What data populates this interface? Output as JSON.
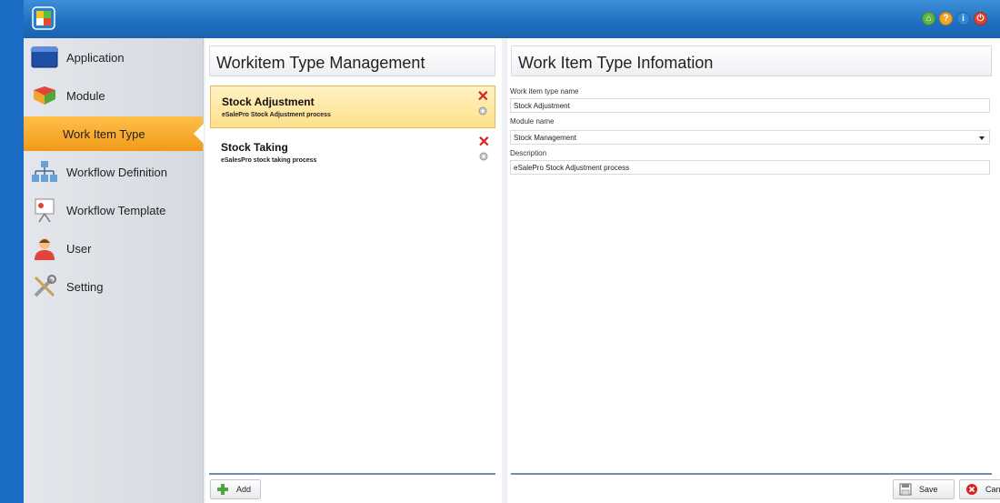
{
  "titlebar": {
    "accent": "#1f6fc2",
    "icons": [
      "home-icon",
      "help-icon",
      "info-icon",
      "power-icon"
    ]
  },
  "sidebar": {
    "items": [
      {
        "label": "Application",
        "icon": "application-window-icon",
        "active": false
      },
      {
        "label": "Module",
        "icon": "module-puzzle-icon",
        "active": false
      },
      {
        "label": "Work Item Type",
        "icon": "",
        "active": true
      },
      {
        "label": "Workflow Definition",
        "icon": "workflow-hierarchy-icon",
        "active": false
      },
      {
        "label": "Workflow Template",
        "icon": "presentation-board-icon",
        "active": false
      },
      {
        "label": "User",
        "icon": "user-icon",
        "active": false
      },
      {
        "label": "Setting",
        "icon": "tools-icon",
        "active": false
      }
    ]
  },
  "list_panel": {
    "title": "Workitem Type Management",
    "items": [
      {
        "name": "Stock Adjustment",
        "description": "eSalePro Stock Adjustment process",
        "selected": true
      },
      {
        "name": "Stock Taking",
        "description": "eSalesPro stock taking process",
        "selected": false
      }
    ],
    "add_label": "Add"
  },
  "detail_panel": {
    "title": "Work Item Type Infomation",
    "type_name_label": "Work item type name",
    "type_name_value": "Stock Adjustment",
    "module_label": "Module name",
    "module_value": "Stock Management",
    "description_label": "Description",
    "description_value": "eSalePro Stock Adjustment process",
    "save_label": "Save",
    "cancel_label": "Cancel"
  },
  "colors": {
    "active_item": "#f6a623",
    "selected_row": "#ffe08a",
    "delete": "#d52222"
  }
}
